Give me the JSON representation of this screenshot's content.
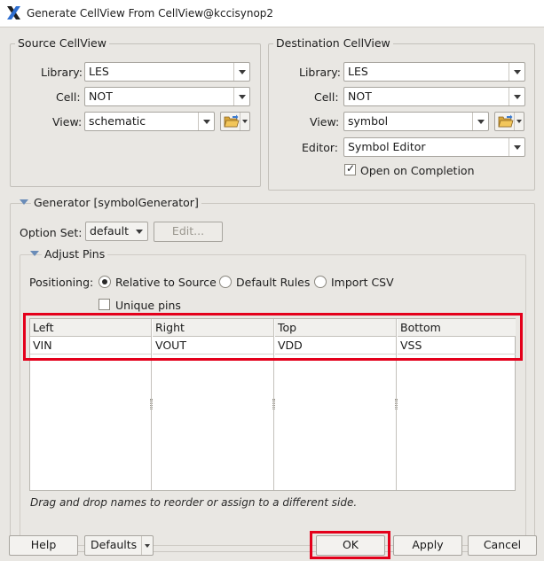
{
  "window": {
    "title": "Generate CellView From CellView@kccisynop2"
  },
  "source": {
    "title": "Source CellView",
    "library_label": "Library:",
    "library_value": "LES",
    "cell_label": "Cell:",
    "cell_value": "NOT",
    "view_label": "View:",
    "view_value": "schematic"
  },
  "destination": {
    "title": "Destination CellView",
    "library_label": "Library:",
    "library_value": "LES",
    "cell_label": "Cell:",
    "cell_value": "NOT",
    "view_label": "View:",
    "view_value": "symbol",
    "editor_label": "Editor:",
    "editor_value": "Symbol Editor",
    "open_on_completion": "Open on Completion",
    "open_on_completion_checked": true
  },
  "generator": {
    "title": "Generator [symbolGenerator]",
    "option_set_label": "Option Set:",
    "option_set_value": "default",
    "edit_button": "Edit..."
  },
  "adjust_pins": {
    "title": "Adjust Pins",
    "positioning_label": "Positioning:",
    "positioning_options": [
      "Relative to Source",
      "Default Rules",
      "Import CSV"
    ],
    "positioning_selected": "Relative to Source",
    "unique_pins": "Unique pins",
    "unique_pins_checked": false,
    "columns": [
      {
        "header": "Left",
        "pins": [
          "VIN"
        ]
      },
      {
        "header": "Right",
        "pins": [
          "VOUT"
        ]
      },
      {
        "header": "Top",
        "pins": [
          "VDD"
        ]
      },
      {
        "header": "Bottom",
        "pins": [
          "VSS"
        ]
      }
    ],
    "hint": "Drag and drop names to reorder or assign to a different side."
  },
  "buttons": {
    "help": "Help",
    "defaults": "Defaults",
    "ok": "OK",
    "apply": "Apply",
    "cancel": "Cancel"
  },
  "colors": {
    "highlight": "#e4001b",
    "dialog_bg": "#e9e7e3",
    "section_arrow": "#6a8cb8"
  },
  "icons": [
    "app-x-icon",
    "folder-open-icon",
    "chevron-down-icon",
    "section-expand-icon",
    "check-icon",
    "radio-selected-icon"
  ]
}
